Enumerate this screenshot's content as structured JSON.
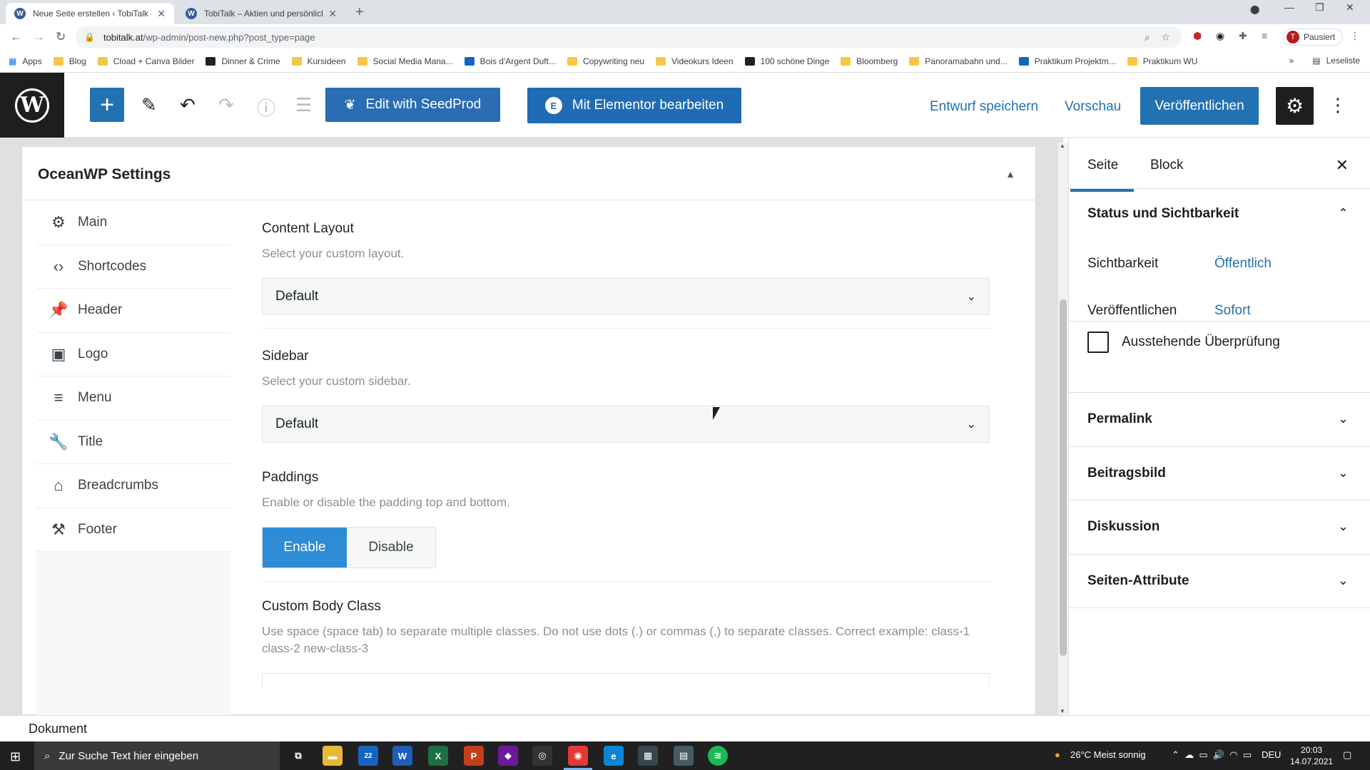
{
  "browser": {
    "tabs": [
      {
        "title": "Neue Seite erstellen ‹ TobiTalk —",
        "active": true
      },
      {
        "title": "TobiTalk – Aktien und persönlich",
        "active": false
      }
    ],
    "new_tab": "+",
    "window_controls": [
      "—",
      "❐",
      "✕"
    ],
    "url_host": "tobitalk.at",
    "url_path": "/wp-admin/post-new.php?post_type=page",
    "profile_initial": "T",
    "profile_status": "Pausiert",
    "bookmarks": [
      {
        "label": "Apps",
        "icon": "apps-grid-icon"
      },
      {
        "label": "Blog",
        "icon": "folder-icon"
      },
      {
        "label": "Cload + Canva Bilder",
        "icon": "folder-icon"
      },
      {
        "label": "Dinner & Crime",
        "icon": "site-icon"
      },
      {
        "label": "Kursideen",
        "icon": "folder-icon"
      },
      {
        "label": "Social Media Mana...",
        "icon": "folder-icon"
      },
      {
        "label": "Bois d'Argent Duft...",
        "icon": "site-icon"
      },
      {
        "label": "Copywriting neu",
        "icon": "folder-icon"
      },
      {
        "label": "Videokurs Ideen",
        "icon": "folder-icon"
      },
      {
        "label": "100 schöne Dinge",
        "icon": "site-icon"
      },
      {
        "label": "Bloomberg",
        "icon": "folder-icon"
      },
      {
        "label": "Panoramabahn und...",
        "icon": "folder-icon"
      },
      {
        "label": "Praktikum Projektm...",
        "icon": "site-icon"
      },
      {
        "label": "Praktikum WU",
        "icon": "folder-icon"
      }
    ],
    "more_bookmarks": "»",
    "reading_list": "Leseliste"
  },
  "toolbar": {
    "seedprod_label": "Edit with SeedProd",
    "elementor_label": "Mit Elementor bearbeiten",
    "save_draft_label": "Entwurf speichern",
    "preview_label": "Vorschau",
    "publish_label": "Veröffentlichen"
  },
  "metabox": {
    "title": "OceanWP Settings",
    "nav": [
      {
        "label": "Main",
        "icon": "gear-icon"
      },
      {
        "label": "Shortcodes",
        "icon": "code-icon"
      },
      {
        "label": "Header",
        "icon": "pin-icon"
      },
      {
        "label": "Logo",
        "icon": "image-icon"
      },
      {
        "label": "Menu",
        "icon": "menu-icon"
      },
      {
        "label": "Title",
        "icon": "wrench-icon"
      },
      {
        "label": "Breadcrumbs",
        "icon": "home-icon"
      },
      {
        "label": "Footer",
        "icon": "hammer-icon"
      }
    ],
    "fields": {
      "content_layout": {
        "label": "Content Layout",
        "desc": "Select your custom layout.",
        "value": "Default"
      },
      "sidebar": {
        "label": "Sidebar",
        "desc": "Select your custom sidebar.",
        "value": "Default"
      },
      "paddings": {
        "label": "Paddings",
        "desc": "Enable or disable the padding top and bottom.",
        "enable": "Enable",
        "disable": "Disable",
        "selected": "Enable"
      },
      "custom_body_class": {
        "label": "Custom Body Class",
        "desc": "Use space (space tab) to separate multiple classes. Do not use dots (.) or commas (,) to separate classes. Correct example: class-1 class-2 new-class-3"
      }
    }
  },
  "footer_breadcrumb": "Dokument",
  "sidebar": {
    "tabs": [
      "Seite",
      "Block"
    ],
    "active_tab": "Seite",
    "status": {
      "title": "Status und Sichtbarkeit",
      "visibility_label": "Sichtbarkeit",
      "visibility_value": "Öffentlich",
      "publish_label": "Veröffentlichen",
      "publish_value": "Sofort",
      "pending_label": "Ausstehende Überprüfung",
      "pending_checked": false
    },
    "panels": [
      "Permalink",
      "Beitragsbild",
      "Diskussion",
      "Seiten-Attribute"
    ]
  },
  "taskbar": {
    "search_placeholder": "Zur Suche Text hier eingeben",
    "mail_badge": "22",
    "weather": "26°C  Meist sonnig",
    "language": "DEU",
    "time": "20:03",
    "date": "14.07.2021"
  },
  "colors": {
    "wp_blue": "#2271b1",
    "wp_dark": "#1e1e1e",
    "enable_blue": "#2e8bd6"
  }
}
